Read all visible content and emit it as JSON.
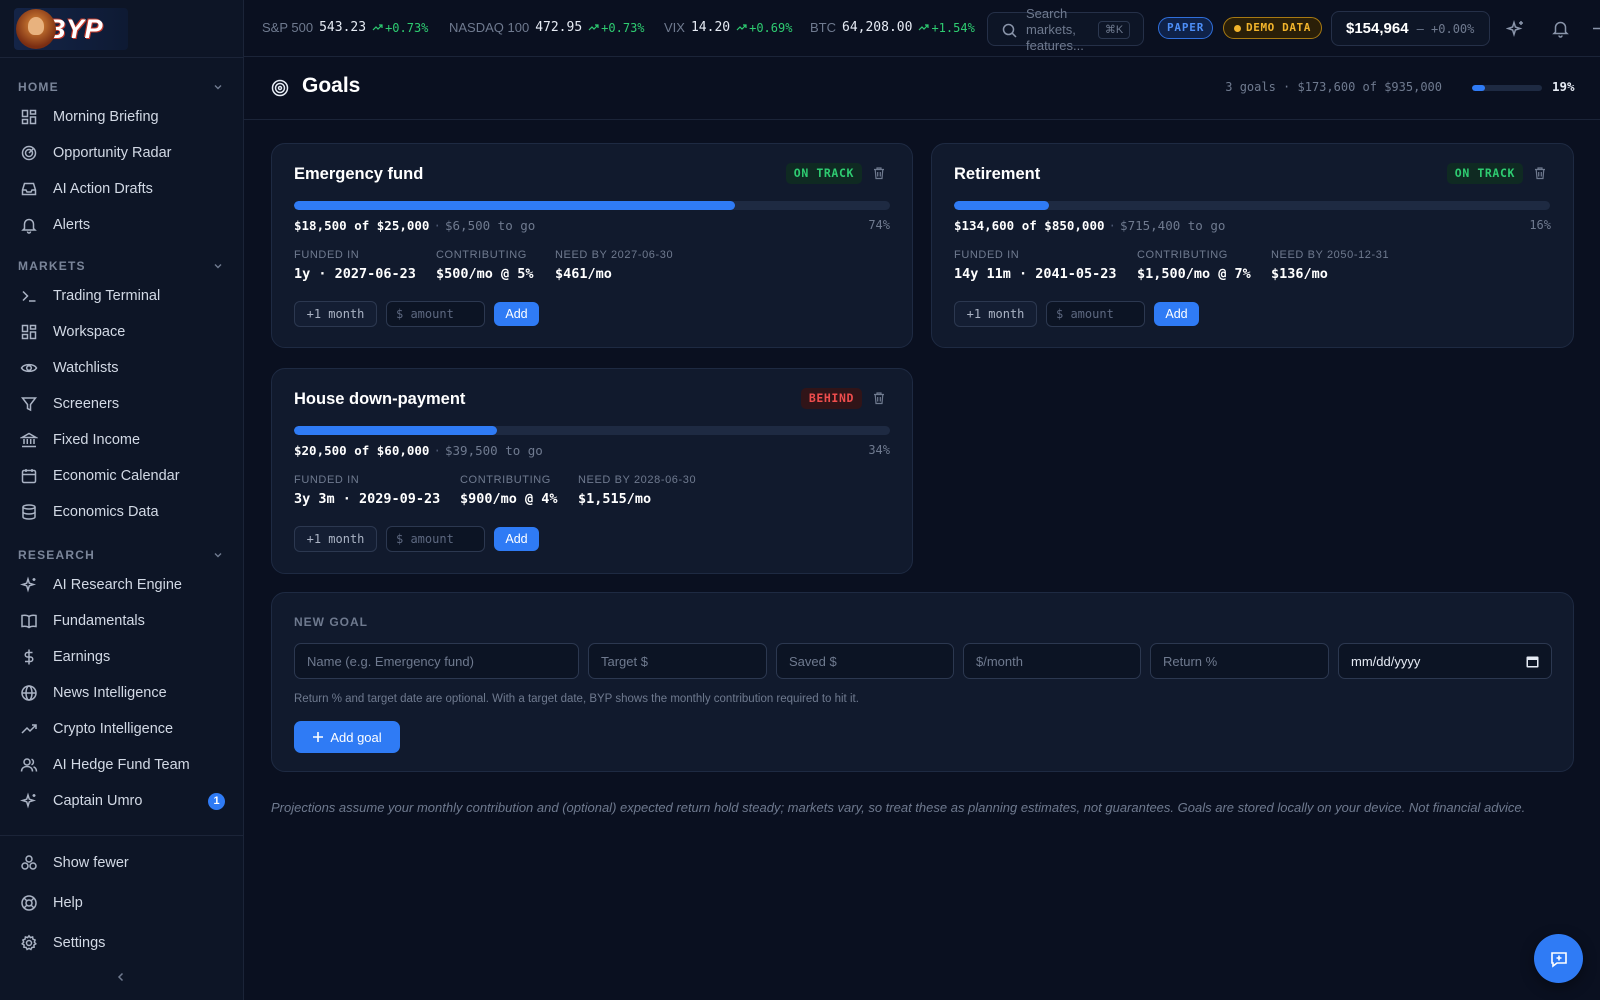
{
  "app": {
    "logo_text": "BYP"
  },
  "sidebar": {
    "sections": [
      {
        "label": "HOME",
        "items": [
          {
            "label": "Morning Briefing",
            "icon": "layout-grid-icon"
          },
          {
            "label": "Opportunity Radar",
            "icon": "radar-icon"
          },
          {
            "label": "AI Action Drafts",
            "icon": "inbox-icon"
          },
          {
            "label": "Alerts",
            "icon": "bell-icon"
          }
        ]
      },
      {
        "label": "MARKETS",
        "items": [
          {
            "label": "Trading Terminal",
            "icon": "terminal-icon"
          },
          {
            "label": "Workspace",
            "icon": "layout-grid-icon"
          },
          {
            "label": "Watchlists",
            "icon": "eye-icon"
          },
          {
            "label": "Screeners",
            "icon": "filter-icon"
          },
          {
            "label": "Fixed Income",
            "icon": "bank-icon"
          },
          {
            "label": "Economic Calendar",
            "icon": "calendar-icon"
          },
          {
            "label": "Economics Data",
            "icon": "database-icon"
          }
        ]
      },
      {
        "label": "RESEARCH",
        "items": [
          {
            "label": "AI Research Engine",
            "icon": "sparkles-icon"
          },
          {
            "label": "Fundamentals",
            "icon": "book-icon"
          },
          {
            "label": "Earnings",
            "icon": "dollar-icon"
          },
          {
            "label": "News Intelligence",
            "icon": "globe-icon"
          },
          {
            "label": "Crypto Intelligence",
            "icon": "trending-up-icon"
          },
          {
            "label": "AI Hedge Fund Team",
            "icon": "users-icon"
          },
          {
            "label": "Captain Umro",
            "icon": "sparkles-icon",
            "badge": "1"
          }
        ]
      }
    ],
    "footer": [
      {
        "label": "Show fewer",
        "icon": "apps-icon"
      },
      {
        "label": "Help",
        "icon": "lifebuoy-icon"
      },
      {
        "label": "Settings",
        "icon": "gear-icon"
      }
    ]
  },
  "tickers": [
    {
      "symbol": "S&P 500",
      "price": "543.23",
      "change": "+0.73%"
    },
    {
      "symbol": "NASDAQ 100",
      "price": "472.95",
      "change": "+0.73%"
    },
    {
      "symbol": "VIX",
      "price": "14.20",
      "change": "+0.69%"
    },
    {
      "symbol": "BTC",
      "price": "64,208.00",
      "change": "+1.54%"
    }
  ],
  "search": {
    "placeholder": "Search markets, features...",
    "shortcut": "⌘K"
  },
  "badges": {
    "paper": "PAPER",
    "demo": "DEMO DATA"
  },
  "account": {
    "balance": "$154,964",
    "change": "+0.00%"
  },
  "page": {
    "title": "Goals",
    "summary": "3 goals · $173,600 of $935,000",
    "summary_pct": "19%",
    "summary_fraction": 0.19
  },
  "goals": [
    {
      "name": "Emergency fund",
      "status": "ON TRACK",
      "status_kind": "on",
      "saved_of_target": "$18,500 of $25,000",
      "to_go": "$6,500 to go",
      "pct": "74%",
      "fraction": 0.74,
      "funded_label": "FUNDED IN",
      "funded_value": "1y · 2027-06-23",
      "contrib_label": "CONTRIBUTING",
      "contrib_value": "$500/mo @ 5%",
      "need_label": "NEED BY 2027-06-30",
      "need_value": "$461/mo",
      "month_btn": "+1 month",
      "amount_placeholder": "$ amount",
      "add_btn": "Add"
    },
    {
      "name": "Retirement",
      "status": "ON TRACK",
      "status_kind": "on",
      "saved_of_target": "$134,600 of $850,000",
      "to_go": "$715,400 to go",
      "pct": "16%",
      "fraction": 0.16,
      "funded_label": "FUNDED IN",
      "funded_value": "14y 11m · 2041-05-23",
      "contrib_label": "CONTRIBUTING",
      "contrib_value": "$1,500/mo @ 7%",
      "need_label": "NEED BY 2050-12-31",
      "need_value": "$136/mo",
      "month_btn": "+1 month",
      "amount_placeholder": "$ amount",
      "add_btn": "Add"
    },
    {
      "name": "House down-payment",
      "status": "BEHIND",
      "status_kind": "behind",
      "saved_of_target": "$20,500 of $60,000",
      "to_go": "$39,500 to go",
      "pct": "34%",
      "fraction": 0.34,
      "funded_label": "FUNDED IN",
      "funded_value": "3y 3m · 2029-09-23",
      "contrib_label": "CONTRIBUTING",
      "contrib_value": "$900/mo @ 4%",
      "need_label": "NEED BY 2028-06-30",
      "need_value": "$1,515/mo",
      "month_btn": "+1 month",
      "amount_placeholder": "$ amount",
      "add_btn": "Add"
    }
  ],
  "new_goal": {
    "label": "NEW GOAL",
    "placeholders": {
      "name": "Name (e.g. Emergency fund)",
      "target": "Target $",
      "saved": "Saved $",
      "monthly": "$/month",
      "return": "Return %"
    },
    "date_value": "mm/dd/yyyy",
    "hint": "Return % and target date are optional. With a target date, BYP shows the monthly contribution required to hit it.",
    "button": "Add goal"
  },
  "disclaimer": "Projections assume your monthly contribution and (optional) expected return hold steady; markets vary, so treat these as planning estimates, not guarantees. Goals are stored locally on your device. Not financial advice.",
  "colors": {
    "accent": "#2f7bf5",
    "positive": "#2ecc71",
    "negative": "#ef4d4d",
    "warning": "#f2b42b",
    "background": "#0a1020",
    "card": "#111a2d"
  }
}
